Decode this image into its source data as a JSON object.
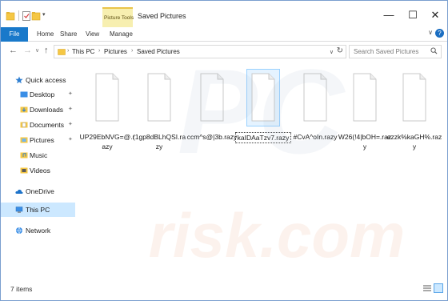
{
  "window": {
    "title": "Saved Pictures",
    "context_tab": "Picture Tools",
    "controls": {
      "minimize": "—",
      "maximize": "☐",
      "close": "✕"
    }
  },
  "ribbon": {
    "tabs": [
      "File",
      "Home",
      "Share",
      "View",
      "Manage"
    ],
    "active_tab": "File",
    "accent": "#1979ca",
    "chevron": "∨",
    "help": "?"
  },
  "navigation": {
    "back": "←",
    "forward": "→",
    "recent": "∨",
    "up": "↑"
  },
  "address": {
    "crumbs": [
      "This PC",
      "Pictures",
      "Saved Pictures"
    ],
    "separator": "›",
    "dropdown": "∨",
    "refresh": "↻"
  },
  "search": {
    "placeholder": "Search Saved Pictures",
    "icon": "search-icon"
  },
  "sidebar": {
    "items": [
      {
        "label": "Quick access",
        "icon": "star-icon",
        "pinned": false
      },
      {
        "label": "Desktop",
        "icon": "desktop-folder-icon",
        "pinned": true
      },
      {
        "label": "Downloads",
        "icon": "downloads-folder-icon",
        "pinned": true
      },
      {
        "label": "Documents",
        "icon": "documents-folder-icon",
        "pinned": true
      },
      {
        "label": "Pictures",
        "icon": "pictures-folder-icon",
        "pinned": true
      },
      {
        "label": "Music",
        "icon": "music-folder-icon",
        "pinned": false
      },
      {
        "label": "Videos",
        "icon": "videos-folder-icon",
        "pinned": false
      },
      {
        "label": "OneDrive",
        "icon": "cloud-icon",
        "pinned": false
      },
      {
        "label": "This PC",
        "icon": "computer-icon",
        "pinned": false,
        "selected": true
      },
      {
        "label": "Network",
        "icon": "network-icon",
        "pinned": false
      }
    ],
    "pin_glyph": "📌"
  },
  "files": [
    {
      "name": "UP29EbNVG=@.razy"
    },
    {
      "name": "(1gp8dBLhQSI.razy"
    },
    {
      "name": "ccm^s@|3b.razy"
    },
    {
      "name": "kaIDAaTzv7.razy",
      "selected": true
    },
    {
      "name": "#CvA^oIn.razy"
    },
    {
      "name": "W26(!4|bOH=.razy"
    },
    {
      "name": "ezzk%kaGH%.razy"
    }
  ],
  "status": {
    "count": "7 items"
  },
  "watermark": {
    "text": "risk.com",
    "logo": "PC"
  }
}
